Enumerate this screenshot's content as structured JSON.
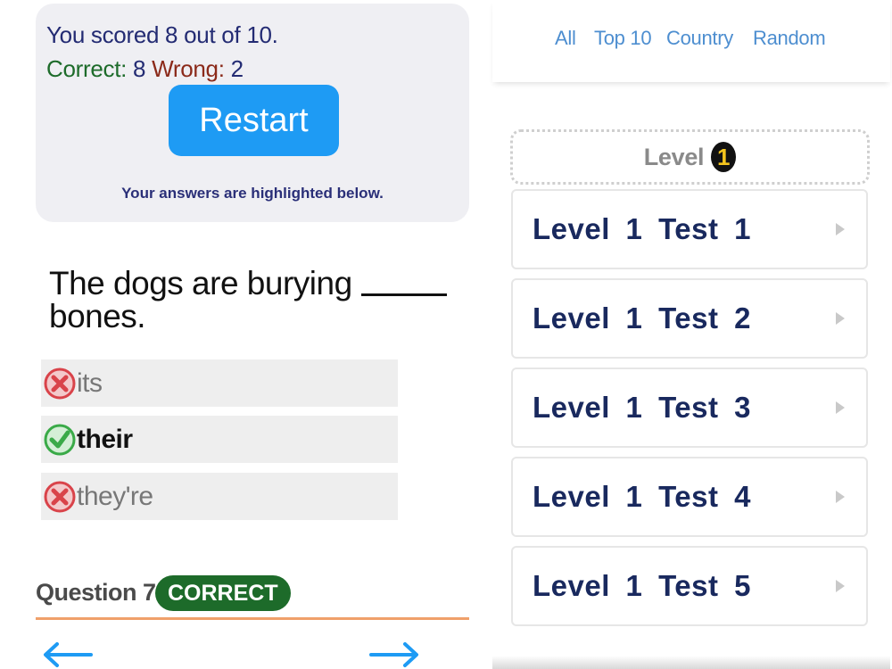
{
  "results": {
    "score_text": "You scored 8 out of 10.",
    "correct_label": "Correct:",
    "correct_count": "8",
    "wrong_label": "Wrong:",
    "wrong_count": "2",
    "restart_label": "Restart",
    "hint": "Your answers are highlighted below."
  },
  "question": {
    "text": "The dogs are burying",
    "text_after_blank": "bones.",
    "answers": [
      {
        "text": "its",
        "status": "wrong",
        "icon": "x-circle-icon",
        "chosen": false
      },
      {
        "text": "their",
        "status": "correct",
        "icon": "check-circle-icon",
        "chosen": true
      },
      {
        "text": "they're",
        "status": "wrong",
        "icon": "x-circle-icon",
        "chosen": false
      }
    ],
    "number_label": "Question 7",
    "status_badge": "CORRECT"
  },
  "navigation": {
    "prev_icon": "arrow-left-icon",
    "next_icon": "arrow-right-icon"
  },
  "top_nav": {
    "links": [
      "All",
      "Top 10",
      "Country",
      "Random"
    ]
  },
  "level": {
    "label": "Level",
    "number": "1"
  },
  "tests": [
    {
      "label": "Level 1 Test 1"
    },
    {
      "label": "Level 1 Test 2"
    },
    {
      "label": "Level 1 Test 3"
    },
    {
      "label": "Level 1 Test 4"
    },
    {
      "label": "Level 1 Test 5"
    }
  ],
  "colors": {
    "accent_blue": "#1e9bf4",
    "correct_green": "#1d6b2a",
    "wrong_red": "#d9434a",
    "link_blue": "#4d8ed0",
    "navy_text": "#19295e",
    "divider_orange": "#f0a06a"
  }
}
